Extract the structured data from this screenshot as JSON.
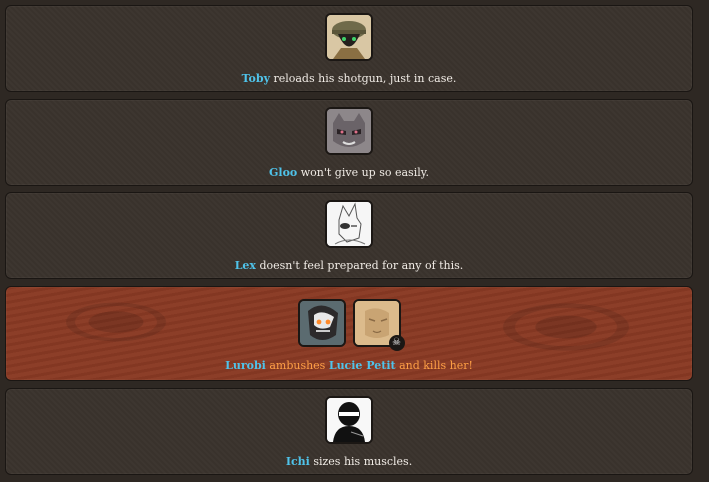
{
  "events": [
    {
      "type": "normal",
      "actor": "Toby",
      "text": " reloads his shotgun, just in case.",
      "avatars": [
        "toby-avatar"
      ]
    },
    {
      "type": "normal",
      "actor": "Gloo",
      "text": " won't give up so easily.",
      "avatars": [
        "gloo-avatar"
      ]
    },
    {
      "type": "normal",
      "actor": "Lex",
      "text": " doesn't feel prepared for any of this.",
      "avatars": [
        "lex-avatar"
      ]
    },
    {
      "type": "kill",
      "actor": "Lurobi",
      "verb": " ambushes ",
      "target": "Lucie Petit",
      "outcome": " and kills her!",
      "avatars": [
        "lurobi-avatar",
        "lucie-petit-avatar"
      ],
      "dead_icon": "skull-icon"
    },
    {
      "type": "normal",
      "actor": "Ichi",
      "text": " sizes his muscles.",
      "avatars": [
        "ichi-avatar"
      ]
    }
  ],
  "colors": {
    "background": "#2e2823",
    "panel": "#3a332d",
    "kill_panel": "#8a3a24",
    "name": "#4fc3ea",
    "kill_text": "#ffa046",
    "text": "#f1ece6"
  }
}
